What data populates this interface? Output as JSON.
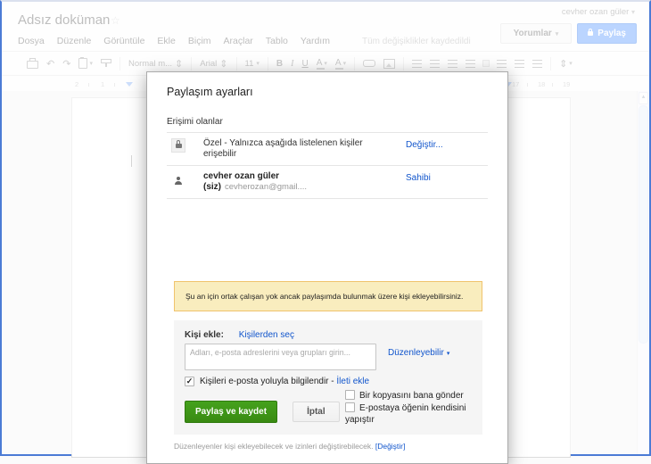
{
  "header": {
    "doc_title": "Adsız doküman",
    "account_name": "cevher ozan güler",
    "menu": [
      "Dosya",
      "Düzenle",
      "Görüntüle",
      "Ekle",
      "Biçim",
      "Araçlar",
      "Tablo",
      "Yardım"
    ],
    "save_status": "Tüm değişiklikler kaydedildi",
    "comments_button": "Yorumlar",
    "share_button": "Paylaş"
  },
  "toolbar": {
    "style_dropdown": "Normal m...",
    "font_dropdown": "Arial",
    "size_dropdown": "11",
    "bold": "B",
    "italic": "I",
    "underline": "U",
    "text_color": "A",
    "highlight": "A"
  },
  "ruler": {
    "left": [
      "2",
      "1"
    ],
    "right": [
      "17",
      "18",
      "19"
    ]
  },
  "icons": {
    "star": "☆",
    "dropdown": "▾",
    "undo": "↶",
    "redo": "↷",
    "updown": "⇕",
    "check": "✓",
    "scroll_up": "▴"
  },
  "dialog": {
    "title": "Paylaşım ayarları",
    "access_label": "Erişimi olanlar",
    "access": {
      "row1": {
        "text": "Özel - Yalnızca aşağıda listelenen kişiler erişebilir",
        "action": "Değiştir..."
      },
      "row2": {
        "name": "cevher ozan güler (siz)",
        "email": "cevherozan@gmail....",
        "action": "Sahibi"
      }
    },
    "notice": "Şu an için ortak çalışan yok ancak paylaşımda bulunmak üzere kişi ekleyebilirsiniz.",
    "add_people": {
      "label": "Kişi ekle:",
      "choose_link": "Kişilerden seç",
      "input_placeholder": "Adları, e-posta adreslerini veya grupları girin...",
      "permission_value": "Düzenleyebilir",
      "notify_label": "Kişileri e-posta yoluyla bilgilendir -",
      "add_message_link": "İleti ekle",
      "notify_checked": true,
      "share_save_button": "Paylaş ve kaydet",
      "cancel_button": "İptal",
      "send_copy_label": "Bir kopyasını bana gönder",
      "paste_item_label": "E-postaya öğenin kendisini yapıştır"
    },
    "footer": {
      "text": "Düzenleyenler kişi ekleyebilecek ve izinleri değiştirebilecek.",
      "link": "[Değiştir]"
    }
  },
  "colors": {
    "link_blue": "#1155cc",
    "share_blue": "#4d90fe",
    "notice_bg": "#f9edbe",
    "notice_border": "#f0c36d",
    "green_button": "#3d8b12",
    "window_border": "#4b7bd5"
  }
}
